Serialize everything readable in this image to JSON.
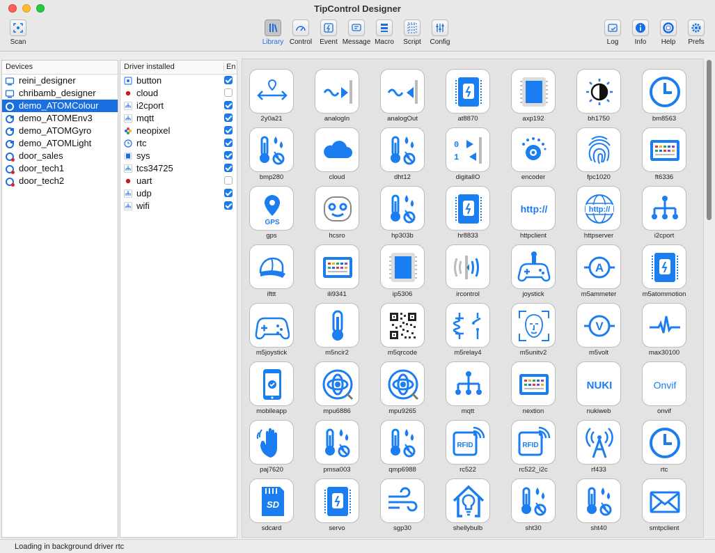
{
  "window": {
    "title": "TipControl Designer"
  },
  "toolbar": {
    "left": [
      {
        "label": "Scan",
        "icon": "scan-icon"
      }
    ],
    "center": [
      {
        "label": "Library",
        "icon": "library-icon",
        "active": true
      },
      {
        "label": "Control",
        "icon": "gauge-icon"
      },
      {
        "label": "Event",
        "icon": "event-icon"
      },
      {
        "label": "Message",
        "icon": "message-icon"
      },
      {
        "label": "Macro",
        "icon": "macro-icon"
      },
      {
        "label": "Script",
        "icon": "script-icon"
      },
      {
        "label": "Config",
        "icon": "sliders-icon"
      }
    ],
    "right": [
      {
        "label": "Log",
        "icon": "log-icon"
      },
      {
        "label": "Info",
        "icon": "info-icon"
      },
      {
        "label": "Help",
        "icon": "lifebuoy-icon"
      },
      {
        "label": "Prefs",
        "icon": "gear-icon"
      }
    ]
  },
  "devices": {
    "header": "Devices",
    "items": [
      {
        "name": "reini_designer",
        "type": "computer"
      },
      {
        "name": "chribamb_designer",
        "type": "computer"
      },
      {
        "name": "demo_ATOMColour",
        "type": "device",
        "selected": true
      },
      {
        "name": "demo_ATOMEnv3",
        "type": "device"
      },
      {
        "name": "demo_ATOMGyro",
        "type": "device"
      },
      {
        "name": "demo_ATOMLight",
        "type": "device"
      },
      {
        "name": "door_sales",
        "type": "device-alert"
      },
      {
        "name": "door_tech1",
        "type": "device-alert"
      },
      {
        "name": "door_tech2",
        "type": "device-alert"
      }
    ]
  },
  "drivers": {
    "header": "Driver installed",
    "enabled_header": "En",
    "items": [
      {
        "name": "button",
        "icon": "button-icon",
        "enabled": true
      },
      {
        "name": "cloud",
        "icon": "red-dot-icon",
        "enabled": false
      },
      {
        "name": "i2cport",
        "icon": "network-icon",
        "enabled": true
      },
      {
        "name": "mqtt",
        "icon": "network-icon",
        "enabled": true
      },
      {
        "name": "neopixel",
        "icon": "flower-icon",
        "enabled": true
      },
      {
        "name": "rtc",
        "icon": "clock-icon",
        "enabled": true
      },
      {
        "name": "sys",
        "icon": "chip-icon",
        "enabled": true
      },
      {
        "name": "tcs34725",
        "icon": "network-icon",
        "enabled": true
      },
      {
        "name": "uart",
        "icon": "red-dot-icon",
        "enabled": false
      },
      {
        "name": "udp",
        "icon": "network-icon",
        "enabled": true
      },
      {
        "name": "wifi",
        "icon": "network-icon",
        "enabled": true
      }
    ]
  },
  "library": {
    "accent": "#1a7df0",
    "items": [
      {
        "label": "2y0a21",
        "icon": "distance-icon"
      },
      {
        "label": "analogIn",
        "icon": "analog-in-icon"
      },
      {
        "label": "analogOut",
        "icon": "analog-out-icon"
      },
      {
        "label": "at8870",
        "icon": "module-icon"
      },
      {
        "label": "axp192",
        "icon": "chip-icon"
      },
      {
        "label": "bh1750",
        "icon": "light-sensor-icon"
      },
      {
        "label": "bm8563",
        "icon": "clock-icon"
      },
      {
        "label": "bmp280",
        "icon": "thermo-drops-icon"
      },
      {
        "label": "cloud",
        "icon": "cloud-icon"
      },
      {
        "label": "dht12",
        "icon": "thermo-drops-icon"
      },
      {
        "label": "digitalIO",
        "icon": "digital-io-icon"
      },
      {
        "label": "encoder",
        "icon": "encoder-icon"
      },
      {
        "label": "fpc1020",
        "icon": "fingerprint-icon"
      },
      {
        "label": "ft6336",
        "icon": "display-icon"
      },
      {
        "label": "gps",
        "icon": "gps-icon"
      },
      {
        "label": "hcsro",
        "icon": "face-scanner-icon"
      },
      {
        "label": "hp303b",
        "icon": "thermo-drops-icon"
      },
      {
        "label": "hr8833",
        "icon": "module-icon"
      },
      {
        "label": "httpclient",
        "icon": "http-icon"
      },
      {
        "label": "httpserver",
        "icon": "http-globe-icon"
      },
      {
        "label": "i2cport",
        "icon": "network-icon"
      },
      {
        "label": "ifttt",
        "icon": "cap-icon"
      },
      {
        "label": "ili9341",
        "icon": "display-icon"
      },
      {
        "label": "ip5306",
        "icon": "chip-icon"
      },
      {
        "label": "ircontrol",
        "icon": "ir-icon"
      },
      {
        "label": "joystick",
        "icon": "joystick-icon"
      },
      {
        "label": "m5ammeter",
        "icon": "ammeter-icon"
      },
      {
        "label": "m5atommotion",
        "icon": "module-icon"
      },
      {
        "label": "m5joystick",
        "icon": "gamepad-icon"
      },
      {
        "label": "m5ncir2",
        "icon": "thermometer-icon"
      },
      {
        "label": "m5qrcode",
        "icon": "qrcode-icon"
      },
      {
        "label": "m5relay4",
        "icon": "relay-icon"
      },
      {
        "label": "m5unitv2",
        "icon": "face-id-icon"
      },
      {
        "label": "m5volt",
        "icon": "voltmeter-icon"
      },
      {
        "label": "max30100",
        "icon": "pulse-icon"
      },
      {
        "label": "mobileapp",
        "icon": "phone-icon"
      },
      {
        "label": "mpu6886",
        "icon": "gyro-icon"
      },
      {
        "label": "mpu9265",
        "icon": "gyro-icon"
      },
      {
        "label": "mqtt",
        "icon": "network-icon"
      },
      {
        "label": "nextion",
        "icon": "display-icon"
      },
      {
        "label": "nukiweb",
        "icon": "nuki-icon",
        "text": "NUKI"
      },
      {
        "label": "onvif",
        "icon": "onvif-icon",
        "text": "Onvif"
      },
      {
        "label": "paj7620",
        "icon": "hand-icon"
      },
      {
        "label": "pmsa003",
        "icon": "thermo-drops-icon"
      },
      {
        "label": "qmp6988",
        "icon": "thermo-drops-icon"
      },
      {
        "label": "rc522",
        "icon": "rfid-icon",
        "text": "RFID"
      },
      {
        "label": "rc522_i2c",
        "icon": "rfid-icon",
        "text": "RFID"
      },
      {
        "label": "rf433",
        "icon": "antenna-icon"
      },
      {
        "label": "rtc",
        "icon": "clock-icon"
      },
      {
        "label": "sdcard",
        "icon": "sdcard-icon"
      },
      {
        "label": "servo",
        "icon": "module-icon"
      },
      {
        "label": "sgp30",
        "icon": "wind-icon"
      },
      {
        "label": "shellybulb",
        "icon": "bulb-home-icon"
      },
      {
        "label": "sht30",
        "icon": "thermo-drops-icon"
      },
      {
        "label": "sht40",
        "icon": "thermo-drops-icon"
      },
      {
        "label": "smtpclient",
        "icon": "mail-icon"
      }
    ]
  },
  "status": {
    "text": "Loading in background driver rtc"
  }
}
